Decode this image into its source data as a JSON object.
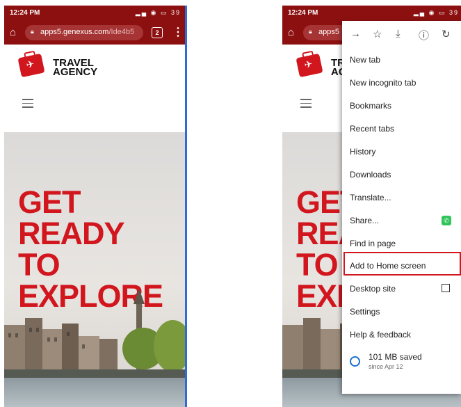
{
  "status_bar": {
    "time": "12:24 PM",
    "icons": "◔ ◷",
    "right_icons": "▂▄ ◉ ▭",
    "battery": "39"
  },
  "browser": {
    "url_host": "apps5.genexus.com",
    "url_path": "/Ide4b5",
    "url_short": "apps5",
    "tab_count": "2"
  },
  "site": {
    "brand_line1": "TRAVEL",
    "brand_line2": "AGENCY",
    "hero_lines": [
      "GET",
      "READY",
      "TO",
      "EXPLORE"
    ]
  },
  "menu": {
    "items": [
      "New tab",
      "New incognito tab",
      "Bookmarks",
      "Recent tabs",
      "History",
      "Downloads",
      "Translate...",
      "Share...",
      "Find in page",
      "Add to Home screen",
      "Desktop site",
      "Settings",
      "Help & feedback"
    ],
    "highlighted": "Add to Home screen",
    "saved_main": "101 MB saved",
    "saved_sub": "since Apr 12"
  },
  "colors": {
    "toolbar": "#8c1010",
    "brand_red": "#d2161e",
    "highlight": "#d2161e",
    "whatsapp": "#31c45a"
  }
}
